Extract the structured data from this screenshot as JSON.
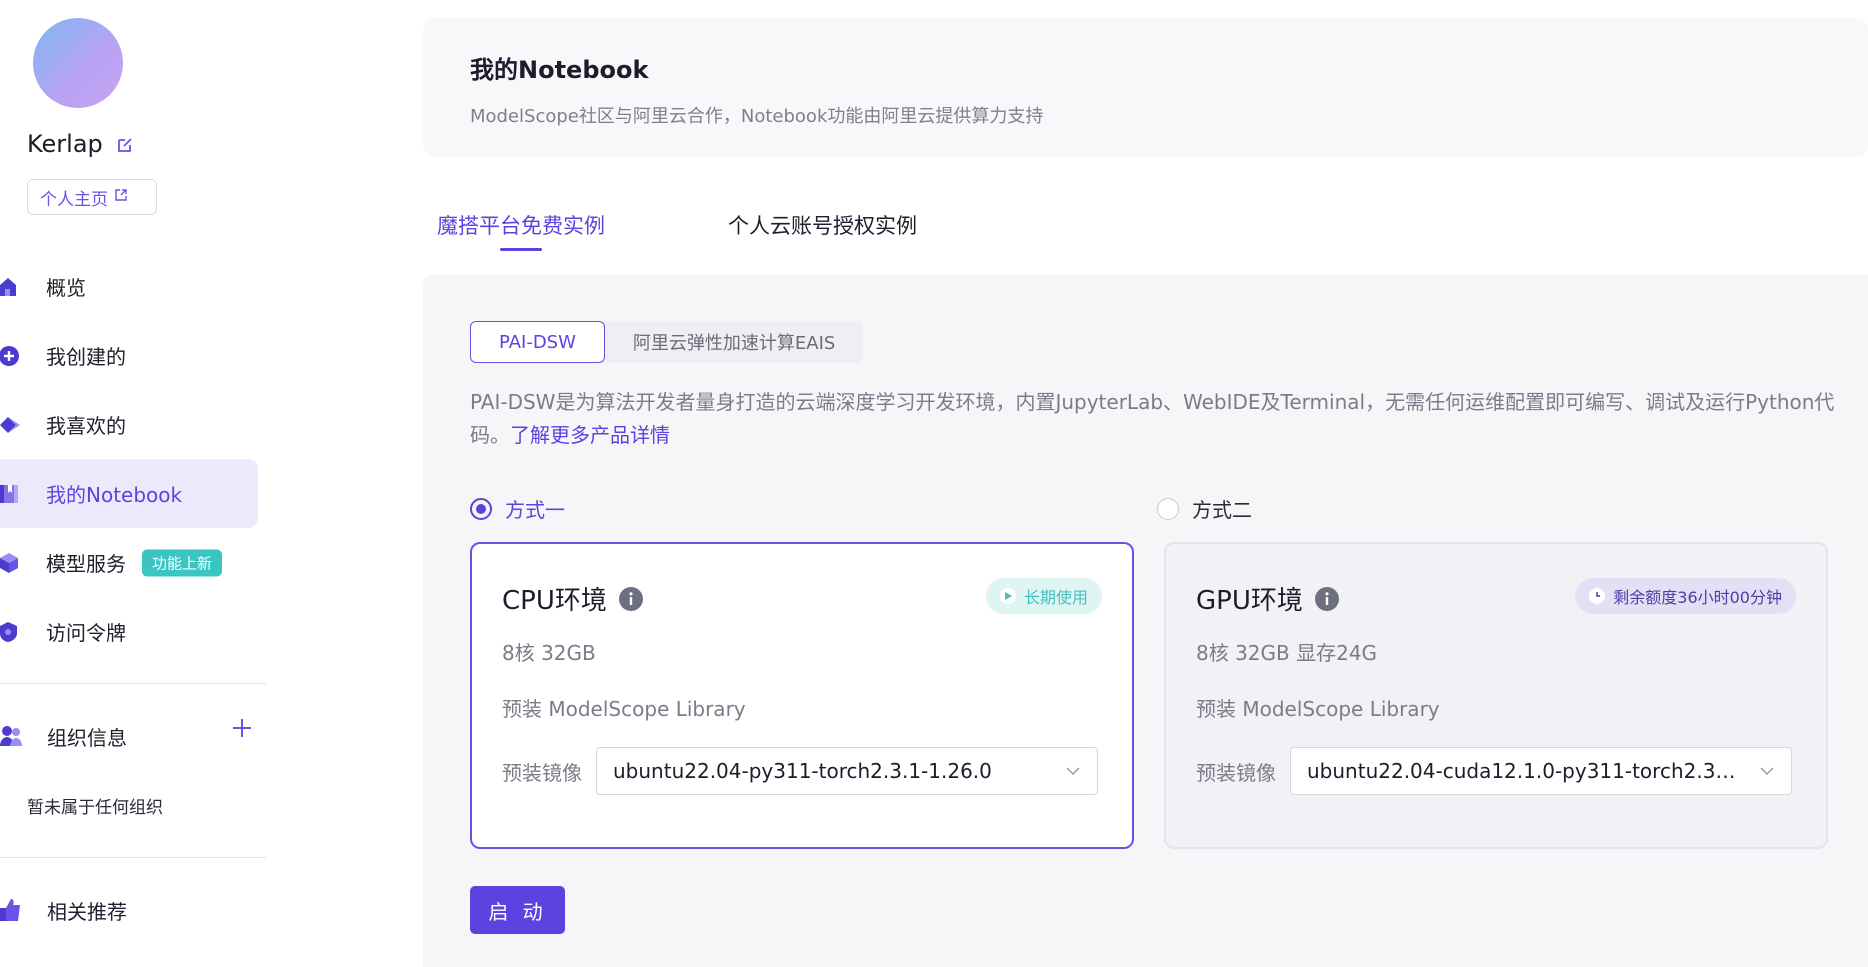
{
  "sidebar": {
    "username": "Kerlap",
    "home_link": "个人主页",
    "items": [
      {
        "label": "概览",
        "icon": "home-icon"
      },
      {
        "label": "我创建的",
        "icon": "create-icon"
      },
      {
        "label": "我喜欢的",
        "icon": "diamond-icon"
      },
      {
        "label": "我的Notebook",
        "icon": "notebook-icon",
        "active": true
      },
      {
        "label": "模型服务",
        "icon": "cube-icon",
        "badge": "功能上新"
      },
      {
        "label": "访问令牌",
        "icon": "shield-icon"
      }
    ],
    "org": {
      "title": "组织信息",
      "empty": "暂未属于任何组织"
    },
    "recommend": "相关推荐"
  },
  "header": {
    "title": "我的Notebook",
    "subtitle": "ModelScope社区与阿里云合作，Notebook功能由阿里云提供算力支持"
  },
  "tabs": [
    "魔搭平台免费实例",
    "个人云账号授权实例"
  ],
  "segments": [
    "PAI-DSW",
    "阿里云弹性加速计算EAIS"
  ],
  "description": {
    "text": "PAI-DSW是为算法开发者量身打造的云端深度学习开发环境，内置JupyterLab、WebIDE及Terminal，无需任何运维配置即可编写、调试及运行Python代码。",
    "link": "了解更多产品详情"
  },
  "options": [
    "方式一",
    "方式二"
  ],
  "cpu": {
    "title": "CPU环境",
    "badge": "长期使用",
    "spec": "8核 32GB",
    "library": "预装 ModelScope Library",
    "image_label": "预装镜像",
    "image_value": "ubuntu22.04-py311-torch2.3.1-1.26.0"
  },
  "gpu": {
    "title": "GPU环境",
    "badge": "剩余额度36小时00分钟",
    "spec": "8核 32GB 显存24G",
    "library": "预装 ModelScope Library",
    "image_label": "预装镜像",
    "image_value": "ubuntu22.04-cuda12.1.0-py311-torch2.3...."
  },
  "start_button": "启 动",
  "colors": {
    "accent": "#5b43e0",
    "teal": "#39c6c3"
  }
}
